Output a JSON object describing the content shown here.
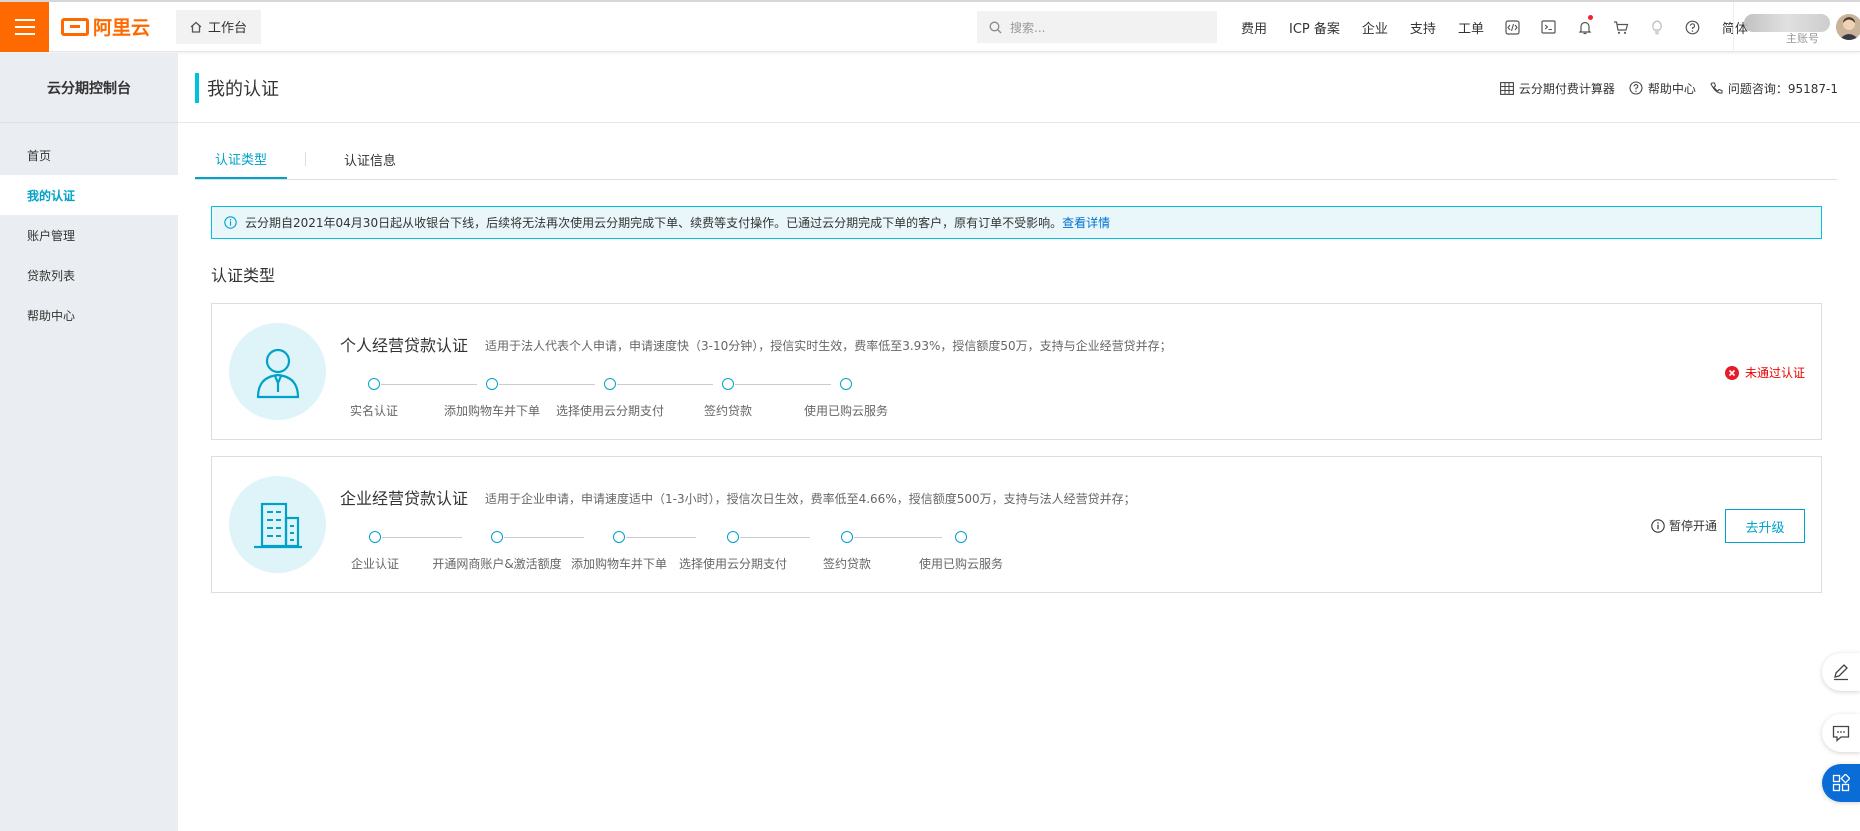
{
  "topbar": {
    "logo_text": "阿里云",
    "workbench_label": "工作台",
    "search_placeholder": "搜索...",
    "nav_links": [
      "费用",
      "ICP 备案",
      "企业",
      "支持",
      "工单"
    ],
    "lang_label": "简体",
    "account_sub": "主账号",
    "accent_color": "#ff6a00"
  },
  "sidebar": {
    "title": "云分期控制台",
    "items": [
      {
        "label": "首页"
      },
      {
        "label": "我的认证"
      },
      {
        "label": "账户管理"
      },
      {
        "label": "贷款列表"
      },
      {
        "label": "帮助中心"
      }
    ]
  },
  "page": {
    "title": "我的认证",
    "links": {
      "calculator": "云分期付费计算器",
      "help": "帮助中心",
      "hotline": "问题咨询：95187-1"
    },
    "tabs": [
      "认证类型",
      "认证信息"
    ]
  },
  "notice": {
    "text": "云分期自2021年04月30日起从收银台下线，后续将无法再次使用云分期完成下单、续费等支付操作。已通过云分期完成下单的客户，原有订单不受影响。",
    "link": "查看详情"
  },
  "section_title": "认证类型",
  "cards": [
    {
      "title": "个人经营贷款认证",
      "desc": "适用于法人代表个人申请，申请速度快（3-10分钟），授信实时生效，费率低至3.93%，授信额度50万，支持与企业经营贷并存；",
      "steps": [
        "实名认证",
        "添加购物车并下单",
        "选择使用云分期支付",
        "签约贷款",
        "使用已购云服务"
      ],
      "status": "未通过认证"
    },
    {
      "title": "企业经营贷款认证",
      "desc": "适用于企业申请，申请速度适中（1-3小时），授信次日生效，费率低至4.66%，授信额度500万，支持与法人经营贷并存；",
      "steps": [
        "企业认证",
        "开通网商账户&激活额度",
        "添加购物车并下单",
        "选择使用云分期支付",
        "签约贷款",
        "使用已购云服务"
      ],
      "status": "暂停开通",
      "button": "去升级"
    }
  ]
}
